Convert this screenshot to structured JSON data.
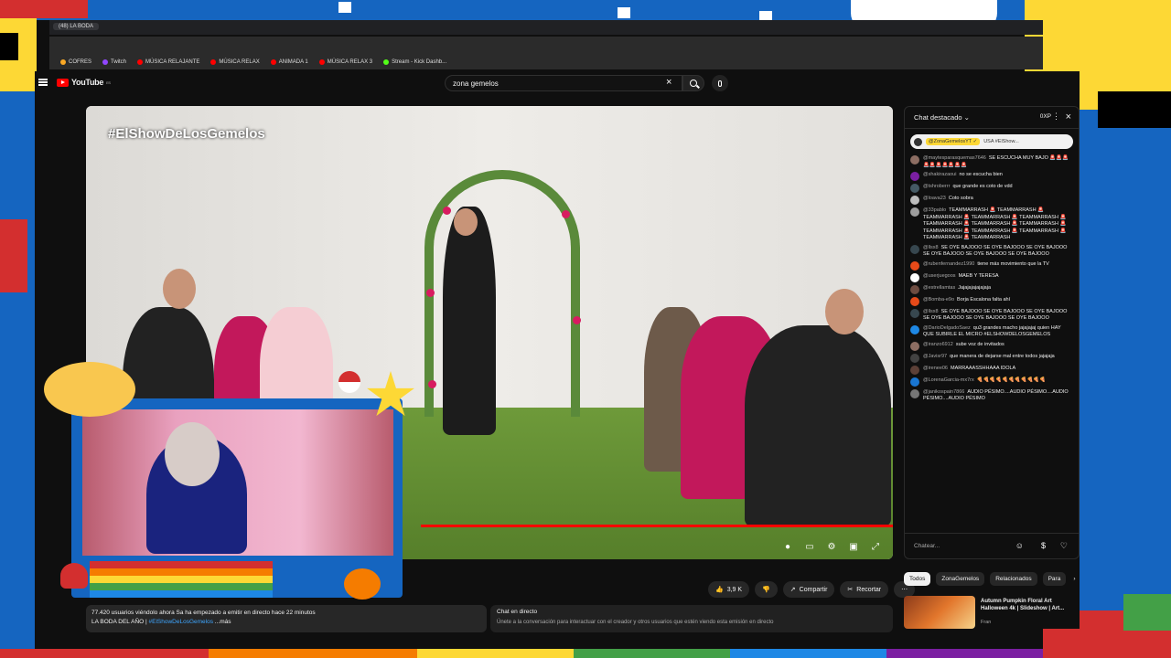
{
  "browser": {
    "tab_title": "(48) LA BODA",
    "bookmarks": [
      {
        "label": "COFRES",
        "color": "#f9a825"
      },
      {
        "label": "Twitch",
        "color": "#9146ff"
      },
      {
        "label": "MÚSICA RELAJANTE",
        "color": "#ff0000"
      },
      {
        "label": "MÚSICA RELAX",
        "color": "#ff0000"
      },
      {
        "label": "ANIMADA 1",
        "color": "#ff0000"
      },
      {
        "label": "MÚSICA RELAX 3",
        "color": "#ff0000"
      },
      {
        "label": "Stream - Kick Dashb...",
        "color": "#53fc18"
      }
    ]
  },
  "youtube": {
    "logo": "YouTube",
    "logo_country": "ES",
    "search_value": "zona gemelos",
    "icons": {
      "menu": "menu-icon",
      "clear": "close-icon",
      "search": "search-icon",
      "mic": "mic-icon"
    }
  },
  "video": {
    "hashtag": "#ElShowDeLosGemelos",
    "progress": 1.0,
    "accent": "#ff0000"
  },
  "actions": {
    "likes": "3,9 K",
    "share": "Compartir",
    "clip": "Recortar",
    "more": "⋯"
  },
  "description": {
    "stats": "77.420 usuarios viéndolo ahora  Sa ha empezado a emitir en directo hace 22 minutos",
    "title_prefix": "LA BODA DEL AÑO |",
    "tag": "#ElShowDeLosGemelos",
    "more": "...más"
  },
  "chat_box": {
    "title": "Chat en directo",
    "sub": "Únete a la conversación para interactuar con el creador y otros usuarios que estén viendo esta emisión en directo"
  },
  "chat": {
    "header": "Chat destacado",
    "xp": "0XP",
    "pinned_user": "@ZonaGemelosYT ✓",
    "pinned_text": "USA #ElShow...",
    "input_placeholder": "Chatear...",
    "messages": [
      {
        "author": "@maytesparasquemas7646",
        "text": "SE ESCUCHA MUY BAJO 🚨🚨🚨🚨🚨🚨🚨🚨🚨🚨",
        "color": "#8d6e63"
      },
      {
        "author": "@shakirazaoui",
        "text": "no se escucha bien",
        "color": "#7b1fa2"
      },
      {
        "author": "@tshroberrr",
        "text": "que grande es coto de vdd",
        "color": "#455a64"
      },
      {
        "author": "@loava23",
        "text": "Coto sobra",
        "color": "#bdbdbd"
      },
      {
        "author": "@33pablo",
        "text": "TEAMMARRASH 🚨 TEAMMARRASH 🚨 TEAMMARRASH 🚨 TEAMMARRASH 🚨 TEAMMARRASH 🚨 TEAMMARRASH 🚨 TEAMMARRASH 🚨 TEAMMARRASH 🚨 TEAMMARRASH 🚨 TEAMMARRASH 🚨 TEAMMARRASH 🚨 TEAMMARRASH 🚨 TEAMMARRASH",
        "color": "#9e9e9e"
      },
      {
        "author": "@llsx8",
        "text": "SE OYE BAJOOO SE OYE BAJOOO SE OYE BAJOOO SE OYE BAJOOO SE OYE BAJOOO SE OYE BAJOOO",
        "color": "#37474f"
      },
      {
        "author": "@rubenfernandez1990",
        "text": "tiene más movimiento que la TV",
        "color": "#e64a19"
      },
      {
        "author": "@userjuegoos",
        "text": "MAEB Y TERESA",
        "color": "#ffffff"
      },
      {
        "author": "@estrellamtas",
        "text": "Jajajajajajajaja",
        "color": "#6d4c41"
      },
      {
        "author": "@Bomba-e9o",
        "text": "Borja Escalona falta ahí",
        "color": "#e64a19"
      },
      {
        "author": "@llsx8",
        "text": "SE OYE BAJOOO SE OYE BAJOOO SE OYE BAJOOO SE OYE BAJOOO SE OYE BAJOOO SE OYE BAJOOO",
        "color": "#37474f"
      },
      {
        "author": "@DarioDelgadoSaez",
        "text": "qu3 grandes macho jajajajaj quien HAY QUE SUBIRLE EL MICRO #ELSHOWDELOSGEMELOS",
        "color": "#1e88e5"
      },
      {
        "author": "@iranzo6912",
        "text": "sube voz de invitados",
        "color": "#8d6e63"
      },
      {
        "author": "@Javisr97",
        "text": "que manera de dejarse mal entre todos jajajaja",
        "color": "#212121"
      },
      {
        "author": "@irenee06",
        "text": "MARRAAASSHHAAA IDOLA",
        "color": "#5d4037"
      },
      {
        "author": "@LorenaGarcia-mx7rx",
        "text": "🍕🍕🍕🍕🍕🍕🍕🍕🍕🍕🍕",
        "color": "#1976d2"
      },
      {
        "author": "@janikospain7866",
        "text": "AUDIO PÉSIMO....AUDIO PÉSIMO....AUDIO PÉSIMO....AUDIO PÉSIMO",
        "color": "#757575"
      }
    ]
  },
  "recommendations": {
    "chips": [
      "Todos",
      "ZonaGemelos",
      "Relacionados",
      "Para"
    ],
    "video_title": "Autumn Pumpkin Floral Art Halloween 4k | Slideshow | Art...",
    "channel": "Fran"
  }
}
